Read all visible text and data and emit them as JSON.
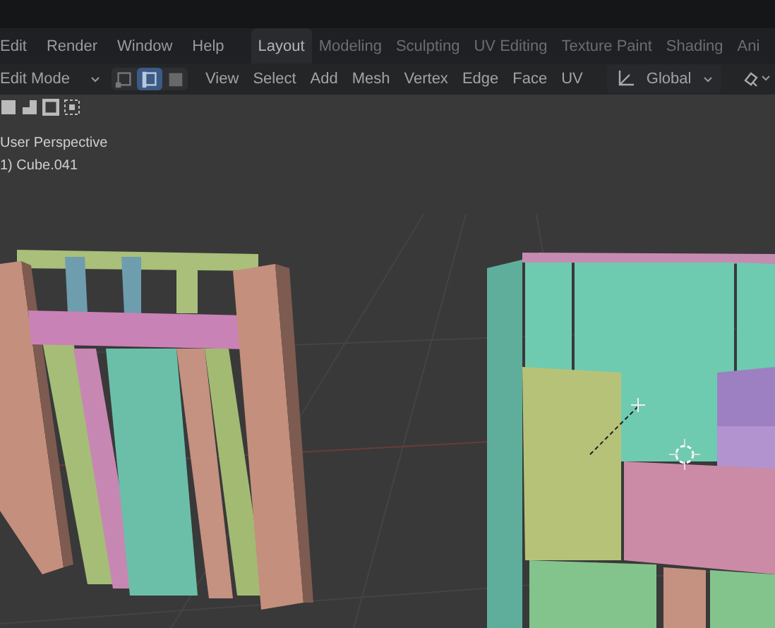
{
  "menu_bar": {
    "menus": [
      "Edit",
      "Render",
      "Window",
      "Help"
    ],
    "workspace_tabs": [
      {
        "label": "Layout",
        "selected": true
      },
      {
        "label": "Modeling",
        "selected": false
      },
      {
        "label": "Sculpting",
        "selected": false
      },
      {
        "label": "UV Editing",
        "selected": false
      },
      {
        "label": "Texture Paint",
        "selected": false
      },
      {
        "label": "Shading",
        "selected": false
      },
      {
        "label": "Ani",
        "selected": false
      }
    ]
  },
  "header": {
    "mode_dropdown": "Edit Mode",
    "select_modes": [
      {
        "kind": "vertex",
        "selected": false
      },
      {
        "kind": "edge",
        "selected": true
      },
      {
        "kind": "face",
        "selected": false
      }
    ],
    "menus": [
      "View",
      "Select",
      "Add",
      "Mesh",
      "Vertex",
      "Edge",
      "Face",
      "UV"
    ],
    "transform_orientation": "Global"
  },
  "viewport": {
    "view_name": "User Perspective",
    "object_name": "1) Cube.041"
  }
}
